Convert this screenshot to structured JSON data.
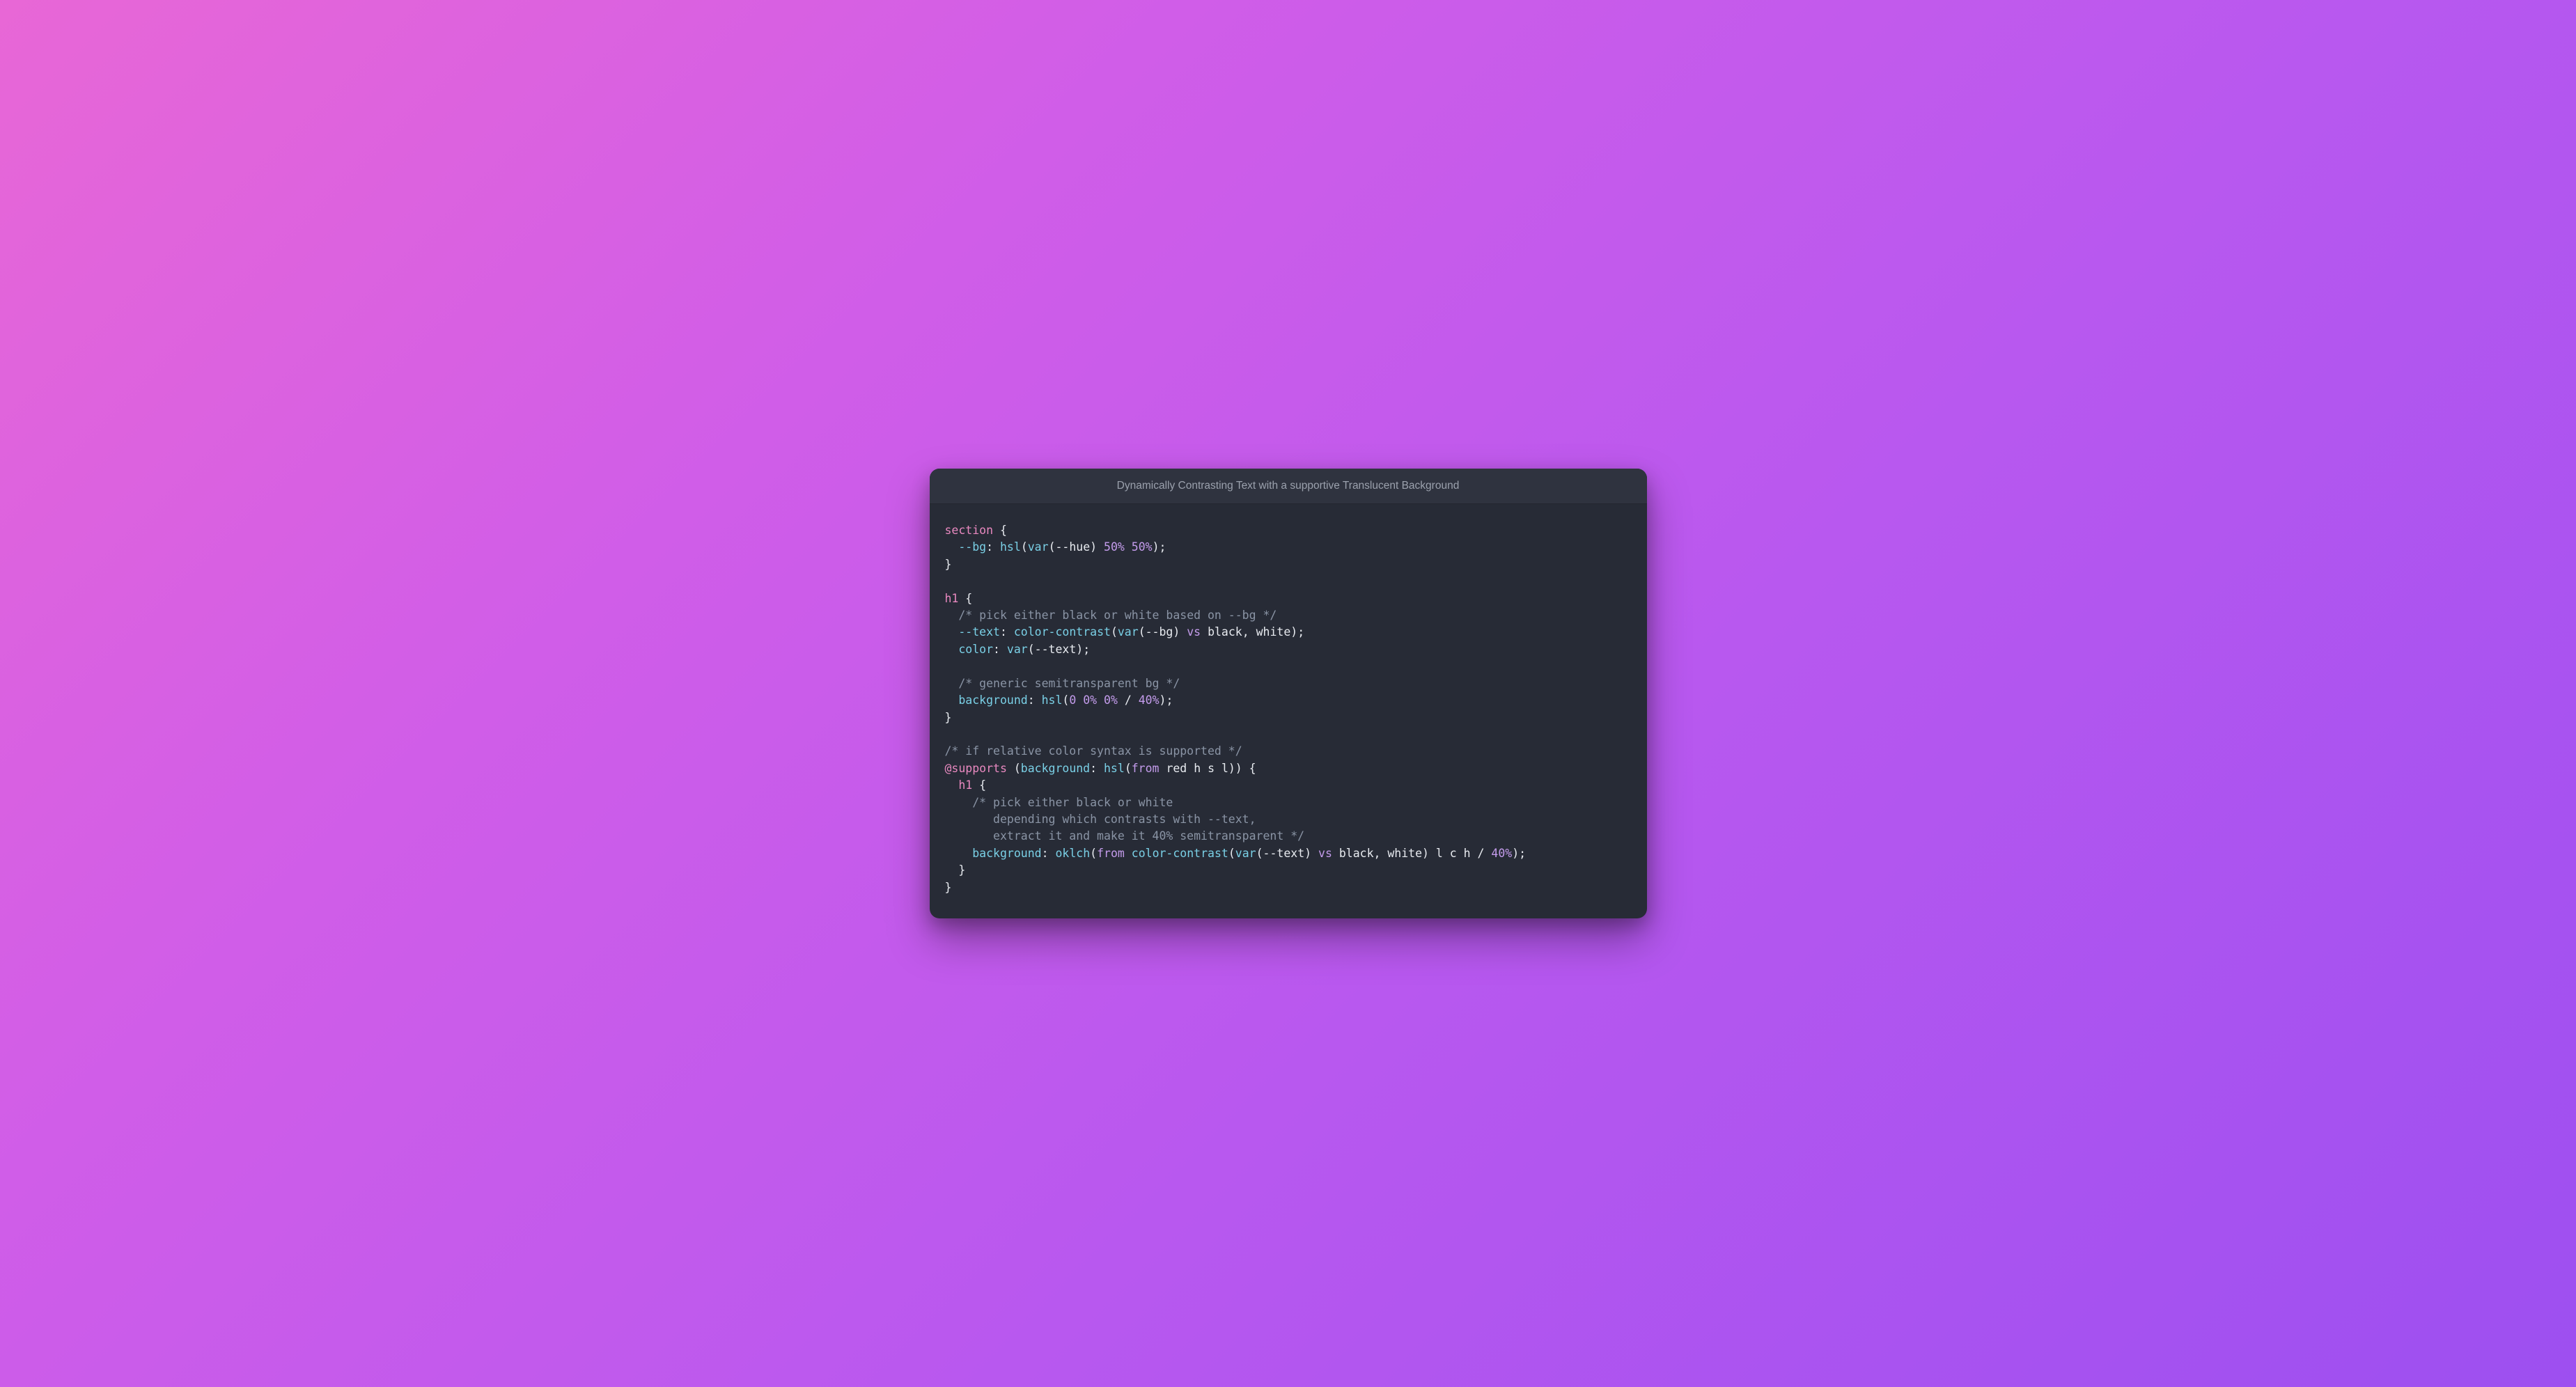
{
  "title": "Dynamically Contrasting Text with a supportive Translucent Background",
  "code": {
    "l1_sel": "section",
    "l2_prop": "--bg",
    "l2_fn_hsl": "hsl",
    "l2_fn_var": "var",
    "l2_var": "--hue",
    "l2_n1": "50%",
    "l2_n2": "50%",
    "l4_sel": "h1",
    "l5_com": "/* pick either black or white based on --bg */",
    "l6_prop": "--text",
    "l6_fn_cc": "color-contrast",
    "l6_fn_var": "var",
    "l6_var": "--bg",
    "l6_vs": "vs",
    "l6_black": "black",
    "l6_white": "white",
    "l7_prop": "color",
    "l7_fn_var": "var",
    "l7_var": "--text",
    "l9_com": "/* generic semitransparent bg */",
    "l10_prop": "background",
    "l10_fn_hsl": "hsl",
    "l10_n1": "0",
    "l10_n2": "0%",
    "l10_n3": "0%",
    "l10_n4": "40%",
    "l12_com": "/* if relative color syntax is supported */",
    "l13_at": "@supports",
    "l13_prop": "background",
    "l13_fn_hsl": "hsl",
    "l13_from": "from",
    "l13_red": "red",
    "l13_h": "h",
    "l13_s": "s",
    "l13_l": "l",
    "l14_sel": "h1",
    "l15_com": "/* pick either black or white\n       depending which contrasts with --text,\n       extract it and make it 40% semitransparent */",
    "l16_prop": "background",
    "l16_fn_oklch": "oklch",
    "l16_from": "from",
    "l16_fn_cc": "color-contrast",
    "l16_fn_var": "var",
    "l16_var": "--text",
    "l16_vs": "vs",
    "l16_black": "black",
    "l16_white": "white",
    "l16_l": "l",
    "l16_c": "c",
    "l16_h": "h",
    "l16_n": "40%"
  }
}
